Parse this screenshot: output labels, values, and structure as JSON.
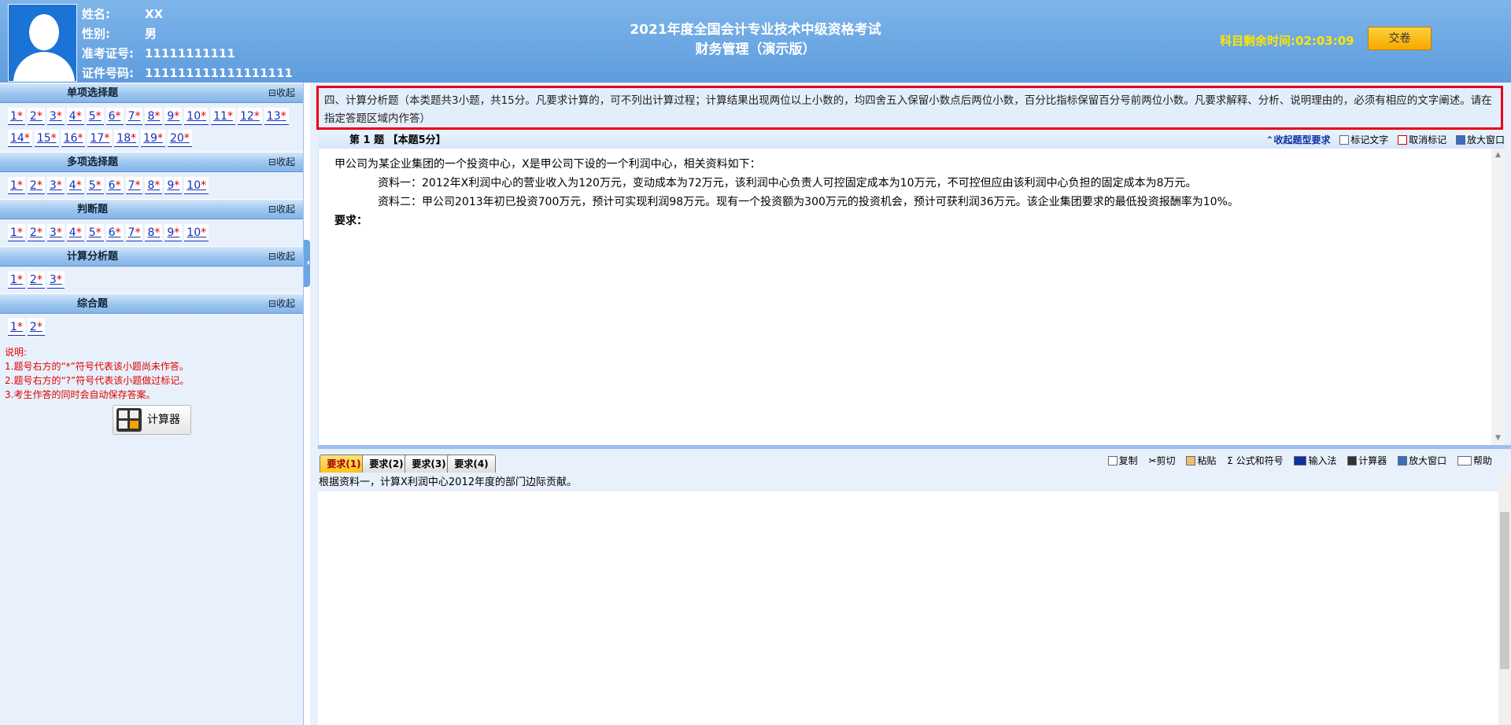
{
  "candidate": {
    "name_label": "姓名:",
    "name_value": "XX",
    "gender_label": "性别:",
    "gender_value": "男",
    "admission_label": "准考证号:",
    "admission_value": "11111111111",
    "id_label": "证件号码:",
    "id_value": "111111111111111111"
  },
  "exam": {
    "title_line1": "2021年度全国会计专业技术中级资格考试",
    "title_line2": "财务管理（演示版）",
    "timer_label": "科目剩余时间:",
    "timer_value": "02:03:09",
    "submit_label": "交卷"
  },
  "sections": [
    {
      "title": "单项选择题",
      "collapse": "收起",
      "questions": [
        "1",
        "2",
        "3",
        "4",
        "5",
        "6",
        "7",
        "8",
        "9",
        "10",
        "11",
        "12",
        "13",
        "14",
        "15",
        "16",
        "17",
        "18",
        "19",
        "20"
      ]
    },
    {
      "title": "多项选择题",
      "collapse": "收起",
      "questions": [
        "1",
        "2",
        "3",
        "4",
        "5",
        "6",
        "7",
        "8",
        "9",
        "10"
      ]
    },
    {
      "title": "判断题",
      "collapse": "收起",
      "questions": [
        "1",
        "2",
        "3",
        "4",
        "5",
        "6",
        "7",
        "8",
        "9",
        "10"
      ]
    },
    {
      "title": "计算分析题",
      "collapse": "收起",
      "questions": [
        "1",
        "2",
        "3"
      ]
    },
    {
      "title": "综合题",
      "collapse": "收起",
      "questions": [
        "1",
        "2"
      ]
    }
  ],
  "unanswered_mark": "*",
  "notes": {
    "title": "说明:",
    "line1": "1.题号右方的“*”符号代表该小题尚未作答。",
    "line2": "2.题号右方的“?”符号代表该小题做过标记。",
    "line3": "3.考生作答的同时会自动保存答案。"
  },
  "calculator_label": "计算器",
  "instruction": "四、计算分析题（本类题共3小题，共15分。凡要求计算的，可不列出计算过程；计算结果出现两位以上小数的，均四舍五入保留小数点后两位小数，百分比指标保留百分号前两位小数。凡要求解释、分析、说明理由的，必须有相应的文字阐述。请在指定答题区域内作答）",
  "question_bar": {
    "number": "第 1 题  【本题5分】",
    "tools": {
      "collapse_req": "收起题型要求",
      "mark_text": "标记文字",
      "unmark": "取消标记",
      "enlarge": "放大窗口"
    }
  },
  "question": {
    "intro": "甲公司为某企业集团的一个投资中心，X是甲公司下设的一个利润中心，相关资料如下：",
    "data1": "资料一：2012年X利润中心的营业收入为120万元，变动成本为72万元，该利润中心负责人可控固定成本为10万元，不可控但应由该利润中心负担的固定成本为8万元。",
    "data2": "资料二：甲公司2013年初已投资700万元，预计可实现利润98万元。现有一个投资额为300万元的投资机会，预计可获利润36万元。该企业集团要求的最低投资报酬率为10%。",
    "requirement_label": "要求："
  },
  "requirement_tabs": [
    "要求(1)",
    "要求(2)",
    "要求(3)",
    "要求(4)"
  ],
  "answer_tools": {
    "copy": "复制",
    "cut": "剪切",
    "paste": "粘贴",
    "formula": "公式和符号",
    "ime": "输入法",
    "calculator": "计算器",
    "enlarge": "放大窗口",
    "help": "帮助"
  },
  "current_requirement": "根据资料一，计算X利润中心2012年度的部门边际贡献。",
  "colors": {
    "header_bg": "#6aa6e3",
    "timer": "#ffe600",
    "submit_button": "#f5b800",
    "instruction_border": "#e8001a",
    "unanswered_star": "#e00000",
    "notes_text": "#e00000"
  }
}
